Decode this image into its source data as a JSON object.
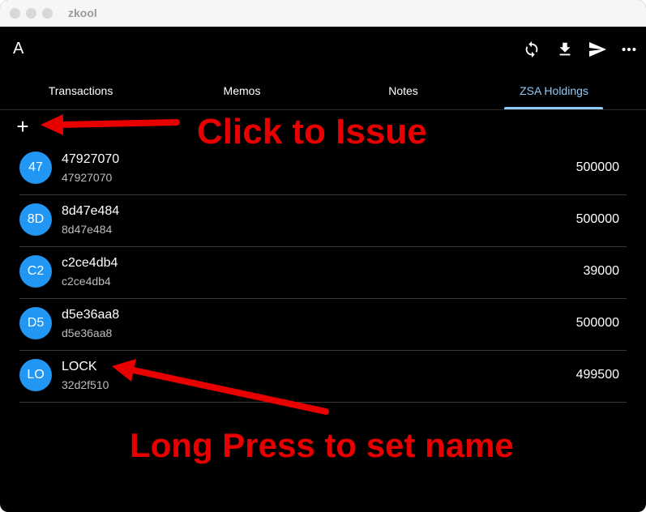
{
  "window": {
    "title": "zkool"
  },
  "appbar": {
    "title": "A",
    "actions": [
      {
        "icon": "sync-icon"
      },
      {
        "icon": "download-icon"
      },
      {
        "icon": "send-icon"
      },
      {
        "icon": "more-icon"
      }
    ]
  },
  "tabs": [
    {
      "label": "Transactions",
      "active": false
    },
    {
      "label": "Memos",
      "active": false
    },
    {
      "label": "Notes",
      "active": false
    },
    {
      "label": "ZSA Holdings",
      "active": true
    }
  ],
  "add_button": {
    "label": "+"
  },
  "holdings": [
    {
      "avatar": "47",
      "name": "47927070",
      "id": "47927070",
      "amount": "500000"
    },
    {
      "avatar": "8D",
      "name": "8d47e484",
      "id": "8d47e484",
      "amount": "500000"
    },
    {
      "avatar": "C2",
      "name": "c2ce4db4",
      "id": "c2ce4db4",
      "amount": "39000"
    },
    {
      "avatar": "D5",
      "name": "d5e36aa8",
      "id": "d5e36aa8",
      "amount": "500000"
    },
    {
      "avatar": "LO",
      "name": "LOCK",
      "id": "32d2f510",
      "amount": "499500"
    }
  ],
  "annotations": {
    "issue": "Click to Issue",
    "long_press": "Long Press to set name"
  },
  "colors": {
    "accent": "#90caf9",
    "avatar": "#2196f3",
    "annotation": "#e80000",
    "background": "#000000"
  }
}
